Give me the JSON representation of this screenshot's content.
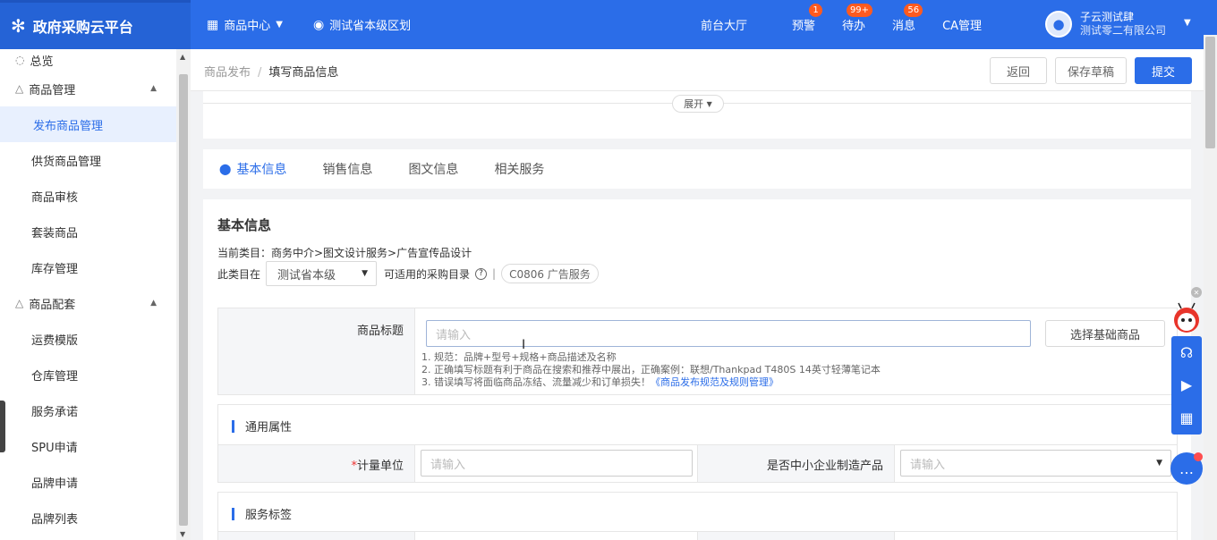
{
  "topbar": {
    "brand_title": "政府采购云平台",
    "nav": [
      {
        "label": "商品中心",
        "icon": "grid-icon"
      },
      {
        "label": "测试省本级区划",
        "icon": "location-icon"
      }
    ],
    "right": [
      {
        "label": "前台大厅",
        "badge": ""
      },
      {
        "label": "预警",
        "badge": "1"
      },
      {
        "label": "待办",
        "badge": "99+"
      },
      {
        "label": "消息",
        "badge": "56"
      },
      {
        "label": "CA管理",
        "badge": ""
      }
    ],
    "user_name": "子云测试肆",
    "user_company": "测试零二有限公司"
  },
  "sidebar": {
    "items": [
      {
        "label": "总览",
        "type": "group"
      },
      {
        "label": "商品管理",
        "type": "group"
      },
      {
        "label": "发布商品管理",
        "type": "item",
        "active": true
      },
      {
        "label": "供货商品管理",
        "type": "item"
      },
      {
        "label": "商品审核",
        "type": "item"
      },
      {
        "label": "套装商品",
        "type": "item"
      },
      {
        "label": "库存管理",
        "type": "item"
      },
      {
        "label": "商品配套",
        "type": "group"
      },
      {
        "label": "运费模版",
        "type": "item"
      },
      {
        "label": "仓库管理",
        "type": "item"
      },
      {
        "label": "服务承诺",
        "type": "item"
      },
      {
        "label": "SPU申请",
        "type": "item"
      },
      {
        "label": "品牌申请",
        "type": "item"
      },
      {
        "label": "品牌列表",
        "type": "item"
      }
    ]
  },
  "header": {
    "breadcrumb_parent": "商品发布",
    "breadcrumb_sep": "/",
    "breadcrumb_current": "填写商品信息",
    "back_label": "返回",
    "save_draft_label": "保存草稿",
    "submit_label": "提交"
  },
  "expand_label": "展开",
  "tabs": [
    "基本信息",
    "销售信息",
    "图文信息",
    "相关服务"
  ],
  "basic": {
    "title": "基本信息",
    "category_line": "当前类目：商务中介>图文设计服务>广告宣传品设计",
    "category_in_label": "此类目在",
    "region_value": "测试省本级",
    "catalog_label": "可适用的采购目录",
    "catalog_separator": "|",
    "catalog_tag": "C0806 广告服务"
  },
  "product_title": {
    "label": "商品标题",
    "placeholder": "请输入",
    "select_base_button": "选择基础商品",
    "hint_1": "1. 规范：品牌+型号+规格+商品描述及名称",
    "hint_2": "2. 正确填写标题有利于商品在搜索和推荐中展出，正确案例：联想/Thankpad T480S 14英寸轻薄笔记本",
    "hint_3_prefix": "3. 错误填写将面临商品冻结、流量减少和订单损失！",
    "hint_3_link": "《商品发布规范及规则管理》"
  },
  "general_attrs": {
    "title": "通用属性",
    "unit_required": "*",
    "unit_label": "计量单位",
    "unit_placeholder": "请输入",
    "sme_label": "是否中小企业制造产品",
    "sme_placeholder": "请输入"
  },
  "service_tags": {
    "title": "服务标签"
  },
  "colors": {
    "primary": "#2b6de8",
    "badge": "#ff5a1f"
  }
}
